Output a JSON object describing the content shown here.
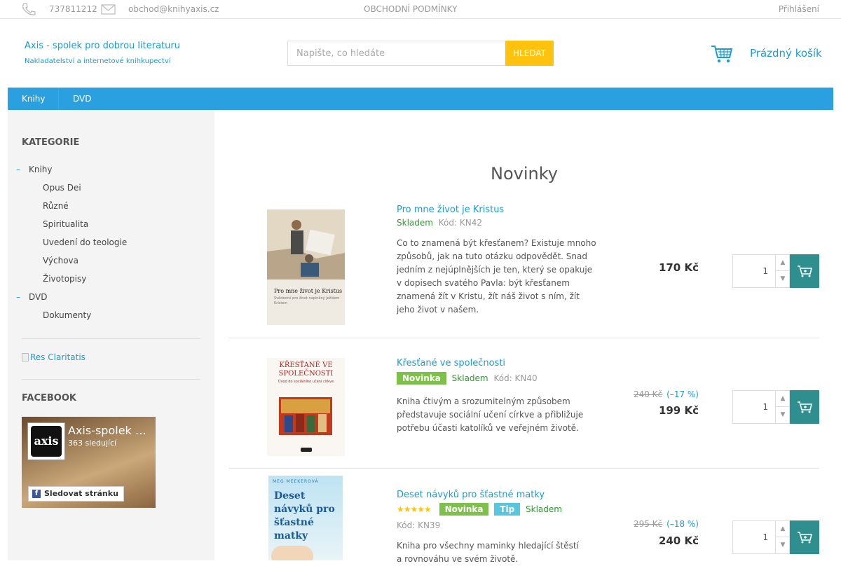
{
  "topbar": {
    "phone": "737811212",
    "email": "obchod@knihyaxis.cz",
    "terms": "OBCHODNÍ PODMÍNKY",
    "login": "Přihlášení"
  },
  "brand": {
    "name": "Axis - spolek pro dobrou literaturu",
    "tagline": "Nakladatelství a internetové knihkupectví"
  },
  "search": {
    "placeholder": "Napište, co hledáte",
    "button": "HLEDAT"
  },
  "cart": {
    "label": "Prázdný košík"
  },
  "nav": [
    "Knihy",
    "DVD"
  ],
  "sidebar": {
    "categories_title": "KATEGORIE",
    "categories": [
      {
        "label": "Knihy",
        "level": 0
      },
      {
        "label": "Opus Dei",
        "level": 1
      },
      {
        "label": "Různé",
        "level": 1
      },
      {
        "label": "Spiritualita",
        "level": 1
      },
      {
        "label": "Uvedení do teologie",
        "level": 1
      },
      {
        "label": "Výchova",
        "level": 1
      },
      {
        "label": "Životopisy",
        "level": 1
      },
      {
        "label": "DVD",
        "level": 0
      },
      {
        "label": "Dokumenty",
        "level": 1
      }
    ],
    "banner_alt": "Res Claritatis",
    "facebook_title": "FACEBOOK",
    "facebook": {
      "logo_text": "axis",
      "page_name": "Axis-spolek pro dobrou literaturu",
      "followers": "363 sledující",
      "follow_button": "Sledovat stránku"
    }
  },
  "main": {
    "title": "Novinky",
    "products": [
      {
        "name": "Pro mne život je Kristus",
        "in_stock": "Skladem",
        "code": "Kód: KN42",
        "badges": [],
        "rating": 0,
        "description": "Co to znamená být křesťanem? Existuje mnoho způsobů, jak na tuto otázku odpovědět. Snad jedním z nejúplnějších je ten, který se opakuje v dopisech svatého Pavla: být křesťanem znamená žít v Kristu, žít náš život s ním, žít jeho život v našem.",
        "old_price": "",
        "discount": "",
        "price": "170 Kč",
        "qty": "1",
        "cover_title": "Pro mne život je Kristus",
        "cover_sub": "Svědectví pro život naplněný Ježíšem Kristem"
      },
      {
        "name": "Křesťané ve společnosti",
        "in_stock": "Skladem",
        "code": "Kód: KN40",
        "badges": [
          "Novinka"
        ],
        "rating": 0,
        "description": "Kniha čtivým a srozumitelným způsobem představuje sociální učení církve a přibližuje potřebu účasti katolíků ve veřejném životě.",
        "old_price": "240 Kč",
        "discount": "(–17 %)",
        "price": "199 Kč",
        "qty": "1",
        "cover_title": "KŘESŤANÉ VE SPOLEČNOSTI",
        "cover_sub": "Úvod do sociálního učení církve"
      },
      {
        "name": "Deset návyků pro šťastné matky",
        "in_stock": "Skladem",
        "code": "Kód: KN39",
        "badges": [
          "Novinka",
          "Tip"
        ],
        "rating": 5,
        "description": "Kniha pro všechny maminky hledající štěstí a rovnováhu ve svém životě.",
        "old_price": "295 Kč",
        "discount": "(–18 %)",
        "price": "240 Kč",
        "qty": "1",
        "cover_author": "MEG MEEKEROVÁ",
        "cover_title": "Deset návyků pro šťastné matky"
      }
    ]
  }
}
